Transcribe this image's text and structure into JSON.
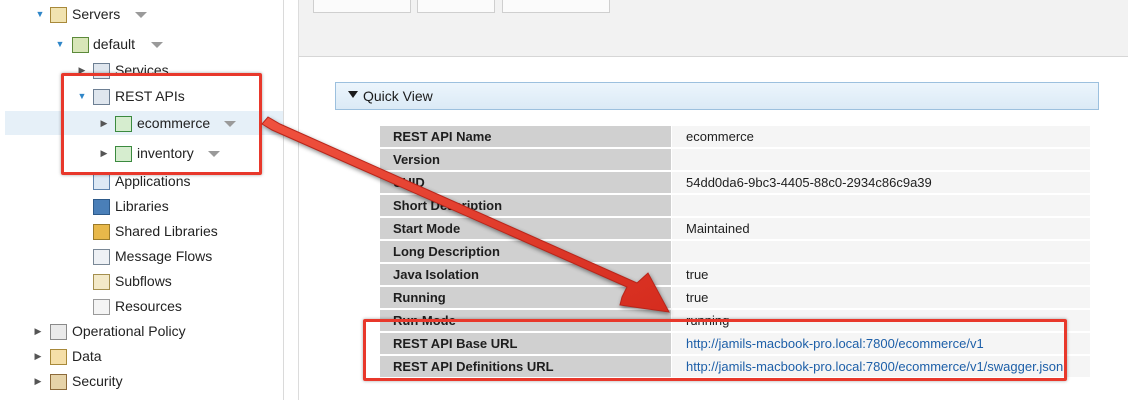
{
  "tree": {
    "items": [
      {
        "label": "Servers",
        "icon": "servers-icon",
        "twisty": "open",
        "dropdown": true
      },
      {
        "label": "default",
        "icon": "server-icon",
        "twisty": "open",
        "dropdown": true
      },
      {
        "label": "Services",
        "icon": "services-icon",
        "twisty": "closed",
        "dropdown": false
      },
      {
        "label": "REST APIs",
        "icon": "rest-apis-icon",
        "twisty": "open",
        "dropdown": false
      },
      {
        "label": "ecommerce",
        "icon": "rest-api-icon",
        "twisty": "closed",
        "dropdown": true,
        "selected": true
      },
      {
        "label": "inventory",
        "icon": "rest-api-icon",
        "twisty": "closed",
        "dropdown": true
      },
      {
        "label": "Applications",
        "icon": "applications-icon",
        "twisty": "none",
        "dropdown": false
      },
      {
        "label": "Libraries",
        "icon": "libraries-icon",
        "twisty": "none",
        "dropdown": false
      },
      {
        "label": "Shared Libraries",
        "icon": "shared-libraries-icon",
        "twisty": "none",
        "dropdown": false
      },
      {
        "label": "Message Flows",
        "icon": "message-flows-icon",
        "twisty": "none",
        "dropdown": false
      },
      {
        "label": "Subflows",
        "icon": "subflows-icon",
        "twisty": "none",
        "dropdown": false
      },
      {
        "label": "Resources",
        "icon": "resources-icon",
        "twisty": "none",
        "dropdown": false
      },
      {
        "label": "Operational Policy",
        "icon": "operational-policy-icon",
        "twisty": "closed",
        "dropdown": false
      },
      {
        "label": "Data",
        "icon": "data-icon",
        "twisty": "closed",
        "dropdown": false
      },
      {
        "label": "Security",
        "icon": "security-icon",
        "twisty": "closed",
        "dropdown": false
      }
    ]
  },
  "quick_view": {
    "title": "Quick View",
    "rows": [
      {
        "key": "REST API Name",
        "value": "ecommerce"
      },
      {
        "key": "Version",
        "value": ""
      },
      {
        "key": "UUID",
        "value": "54dd0da6-9bc3-4405-88c0-2934c86c9a39"
      },
      {
        "key": "Short Description",
        "value": ""
      },
      {
        "key": "Start Mode",
        "value": "Maintained"
      },
      {
        "key": "Long Description",
        "value": ""
      },
      {
        "key": "Java Isolation",
        "value": "true"
      },
      {
        "key": "Running",
        "value": "true"
      },
      {
        "key": "Run Mode",
        "value": "running"
      },
      {
        "key": "REST API Base URL",
        "value": "http://jamils-macbook-pro.local:7800/ecommerce/v1",
        "link": true
      },
      {
        "key": "REST API Definitions URL",
        "value": "http://jamils-macbook-pro.local:7800/ecommerce/v1/swagger.json",
        "link": true
      }
    ]
  },
  "colors": {
    "annotation": "#e8382b",
    "link": "#1d5fa8",
    "selection": "#e6f0f8",
    "accent": "#2f86c8"
  }
}
